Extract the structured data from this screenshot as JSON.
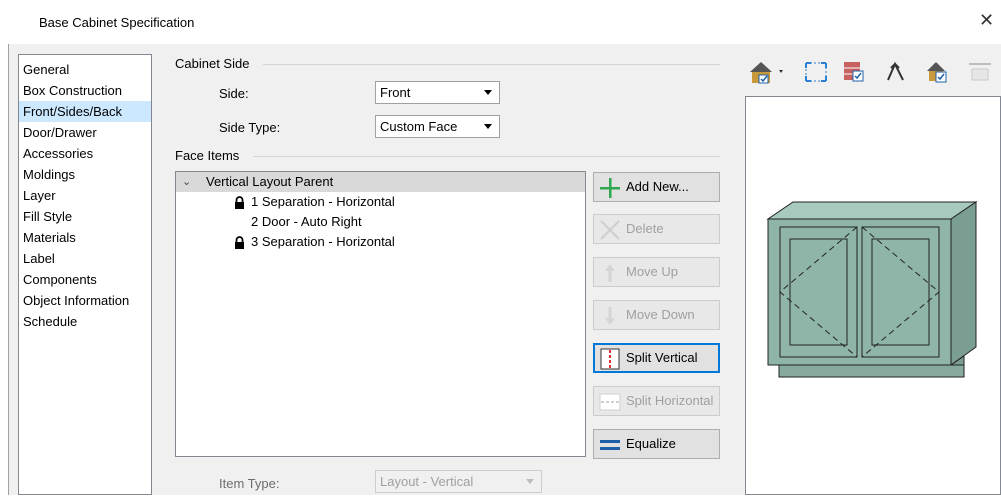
{
  "window": {
    "title": "Base Cabinet Specification",
    "close_glyph": "✕"
  },
  "nav": {
    "items": [
      {
        "label": "General"
      },
      {
        "label": "Box Construction"
      },
      {
        "label": "Front/Sides/Back",
        "selected": true
      },
      {
        "label": "Door/Drawer"
      },
      {
        "label": "Accessories"
      },
      {
        "label": "Moldings"
      },
      {
        "label": "Layer"
      },
      {
        "label": "Fill Style"
      },
      {
        "label": "Materials"
      },
      {
        "label": "Label"
      },
      {
        "label": "Components"
      },
      {
        "label": "Object Information"
      },
      {
        "label": "Schedule"
      }
    ]
  },
  "cabinet_side": {
    "group_label": "Cabinet Side",
    "side_label": "Side:",
    "side_value": "Front",
    "side_type_label": "Side Type:",
    "side_type_value": "Custom Face"
  },
  "face_items": {
    "group_label": "Face Items",
    "tree": {
      "root": "Vertical Layout Parent",
      "children": [
        {
          "label": "1 Separation - Horizontal",
          "locked": true
        },
        {
          "label": "2 Door - Auto Right",
          "locked": false
        },
        {
          "label": "3 Separation - Horizontal",
          "locked": true
        }
      ]
    },
    "buttons": {
      "add_new": "Add New...",
      "delete": "Delete",
      "move_up": "Move Up",
      "move_down": "Move Down",
      "split_vertical": "Split Vertical",
      "split_horizontal": "Split Horizontal",
      "equalize": "Equalize"
    },
    "item_type_label": "Item Type:",
    "item_type_value": "Layout - Vertical"
  },
  "preview": {
    "tool_icons": [
      "camera-view-icon",
      "fill-window-icon",
      "wall-view-icon",
      "orbit-icon",
      "room-view-icon",
      "refresh-icon"
    ],
    "cabinet_color": "#8fb5a8"
  },
  "colors": {
    "selection": "#cce8ff",
    "add_icon": "#2fa84f",
    "split_icon": "#e03030",
    "equalize_icon": "#1f5fa8"
  }
}
